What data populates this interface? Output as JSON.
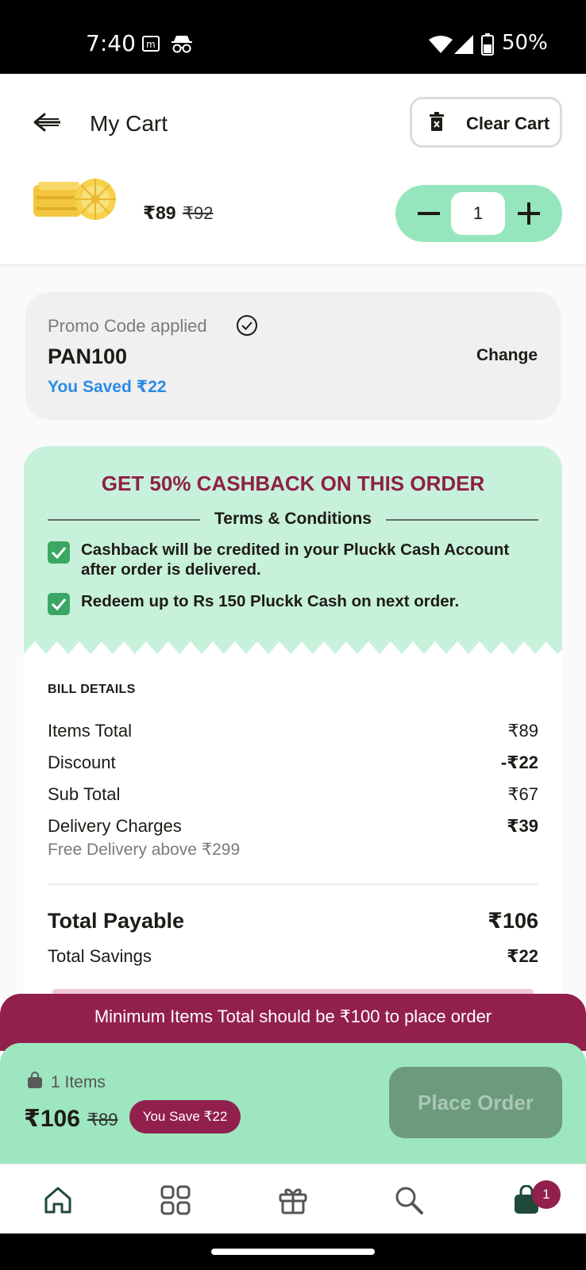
{
  "status_bar": {
    "time": "7:40",
    "battery": "50%"
  },
  "header": {
    "title": "My Cart",
    "clear_cart_label": "Clear Cart"
  },
  "product": {
    "price": "₹89",
    "mrp": "₹92",
    "quantity": "1"
  },
  "promo": {
    "label": "Promo Code applied",
    "code": "PAN100",
    "saved": "You Saved ₹22",
    "change_label": "Change"
  },
  "cashback": {
    "title": "GET 50% CASHBACK ON THIS ORDER",
    "terms_label": "Terms & Conditions",
    "items": [
      "Cashback will be credited in your Pluckk Cash Account after order is delivered.",
      "Redeem up to Rs 150 Pluckk Cash on next order."
    ]
  },
  "bill": {
    "heading": "BILL DETAILS",
    "rows": [
      {
        "label": "Items Total",
        "value": "₹89"
      },
      {
        "label": "Discount",
        "value": "-₹22"
      },
      {
        "label": "Sub Total",
        "value": "₹67"
      },
      {
        "label": "Delivery Charges",
        "value": "₹39"
      }
    ],
    "delivery_note": "Free Delivery above ₹299",
    "total_payable_label": "Total Payable",
    "total_payable_value": "₹106",
    "total_savings_label": "Total Savings",
    "total_savings_value": "₹22"
  },
  "warning": "Minimum Items Total should be ₹100 to place order",
  "order_bar": {
    "items_count": "1 Items",
    "total": "₹106",
    "mrp": "₹89",
    "you_save": "You Save ₹22",
    "place_order_label": "Place Order"
  },
  "bottom_nav": {
    "items": [
      "home-icon",
      "categories-icon",
      "gift-icon",
      "search-icon",
      "cart-icon"
    ],
    "cart_badge": "1"
  },
  "colors": {
    "accent_green": "#96e6bd",
    "cashback_bg": "#c7f1da",
    "brand_maroon": "#92204c",
    "link_blue": "#2a8be5",
    "disabled_button": "#6b9a7c"
  }
}
